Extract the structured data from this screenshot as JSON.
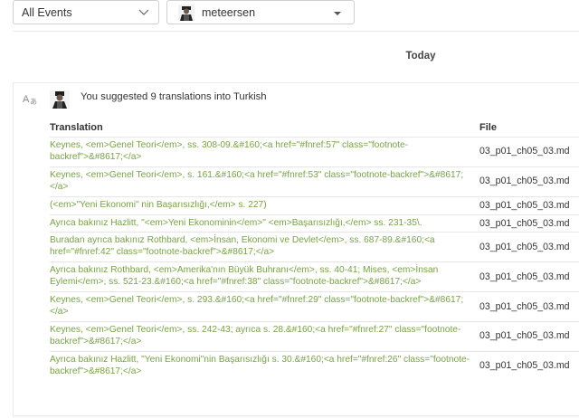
{
  "filters": {
    "event_filter": "All Events",
    "user_filter": "meteersen"
  },
  "timeline": {
    "day_label": "Today"
  },
  "activity": {
    "summary": "You suggested 9 translations into Turkish",
    "columns": {
      "translation": "Translation",
      "file": "File"
    },
    "rows": [
      {
        "translation": "Keynes, <em>Genel Teori</em>, ss. 308-09.&#160;<a href=\"#fnref:57\" class=\"footnote-backref\">&#8617;</a>",
        "file": "03_p01_ch05_03.md"
      },
      {
        "translation": "Keynes, <em>Genel Teori</em>, s. 161.&#160;<a href=\"#fnref:53\" class=\"footnote-backref\">&#8617;</a>",
        "file": "03_p01_ch05_03.md"
      },
      {
        "translation": "(<em>\"Yeni Ekonomi\" nin Başarısızlığı,</em> s. 227)",
        "file": "03_p01_ch05_03.md"
      },
      {
        "translation": "Ayrıca bakınız Hazlitt, \"<em>Yeni Ekonominin</em>\" <em>Başarısızlığı,</em> ss. 231-35\\.",
        "file": "03_p01_ch05_03.md"
      },
      {
        "translation": "Buradan ayrıca bakınız Rothbard, <em>İnsan, Ekonomi ve Devlet</em>, ss. 687-89.&#160;<a href=\"#fnref:42\" class=\"footnote-backref\">&#8617;</a>",
        "file": "03_p01_ch05_03.md"
      },
      {
        "translation": "Ayrıca bakınız Rothbard, <em>Amerika'nın Büyük Buhranı</em>, ss. 40-41; Mises, <em>İnsan Eylemi</em>, ss. 521-23.&#160;<a href=\"#fnref:38\" class=\"footnote-backref\">&#8617;</a>",
        "file": "03_p01_ch05_03.md"
      },
      {
        "translation": "Keynes, <em>Genel Teori</em>, s. 293.&#160;<a href=\"#fnref:29\" class=\"footnote-backref\">&#8617;</a>",
        "file": "03_p01_ch05_03.md"
      },
      {
        "translation": "Keynes, <em>Genel Teori</em>, ss. 242-43; ayrıca s. 28.&#160;<a href=\"#fnref:27\" class=\"footnote-backref\">&#8617;</a>",
        "file": "03_p01_ch05_03.md"
      },
      {
        "translation": "Ayrıca bakınız Hazlitt, \"Yeni Ekonomi\"nin Başarısızlığı s. 30.&#160;<a href=\"#fnref:26\" class=\"footnote-backref\">&#8617;</a>",
        "file": "03_p01_ch05_03.md"
      }
    ]
  },
  "colors": {
    "translation_text": "#76a244",
    "border": "#e6e6e6"
  }
}
